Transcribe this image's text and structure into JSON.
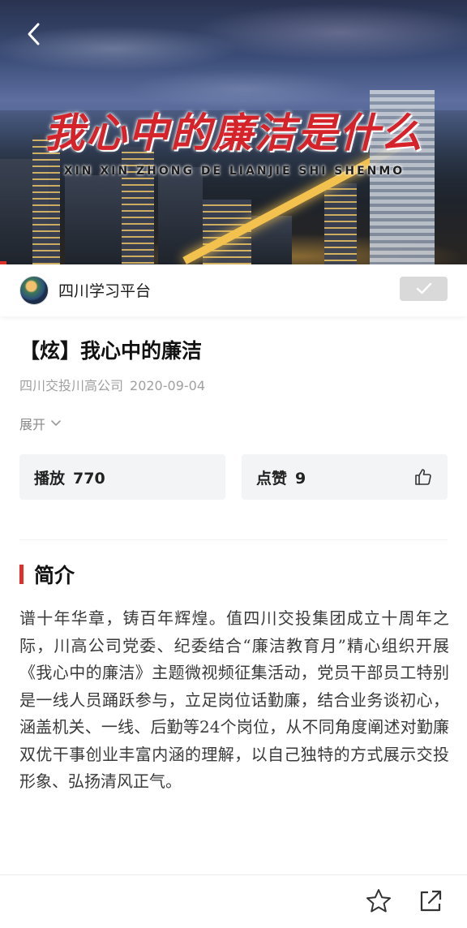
{
  "video": {
    "title_overlay": "我心中的廉洁是什么",
    "subtitle_overlay": "XIN XIN ZHONG DE LIANJIE SHI SHENMO"
  },
  "channel": {
    "name": "四川学习平台",
    "follow_state_icon": "check-icon"
  },
  "article": {
    "title": "【炫】我心中的廉洁",
    "source": "四川交投川高公司",
    "date": "2020-09-04",
    "expand_label": "展开"
  },
  "stats": {
    "plays_label": "播放",
    "plays_value": "770",
    "likes_label": "点赞",
    "likes_value": "9"
  },
  "intro": {
    "heading": "简介",
    "body": "谱十年华章，铸百年辉煌。值四川交投集团成立十周年之际，川高公司党委、纪委结合“廉洁教育月”精心组织开展《我心中的廉洁》主题微视频征集活动，党员干部员工特别是一线人员踊跃参与，立足岗位话勤廉，结合业务谈初心，涵盖机关、一线、后勤等24个岗位，从不同角度阐述对勤廉双优干事创业丰富内涵的理解，以自己独特的方式展示交投形象、弘扬清风正气。"
  },
  "colors": {
    "accent": "#e0302b",
    "card_bg": "#f3f4f5",
    "meta_gray": "#a0a0a0"
  },
  "icons": [
    "back-icon",
    "check-icon",
    "chevron-down-icon",
    "thumbs-up-icon",
    "star-icon",
    "share-icon"
  ]
}
